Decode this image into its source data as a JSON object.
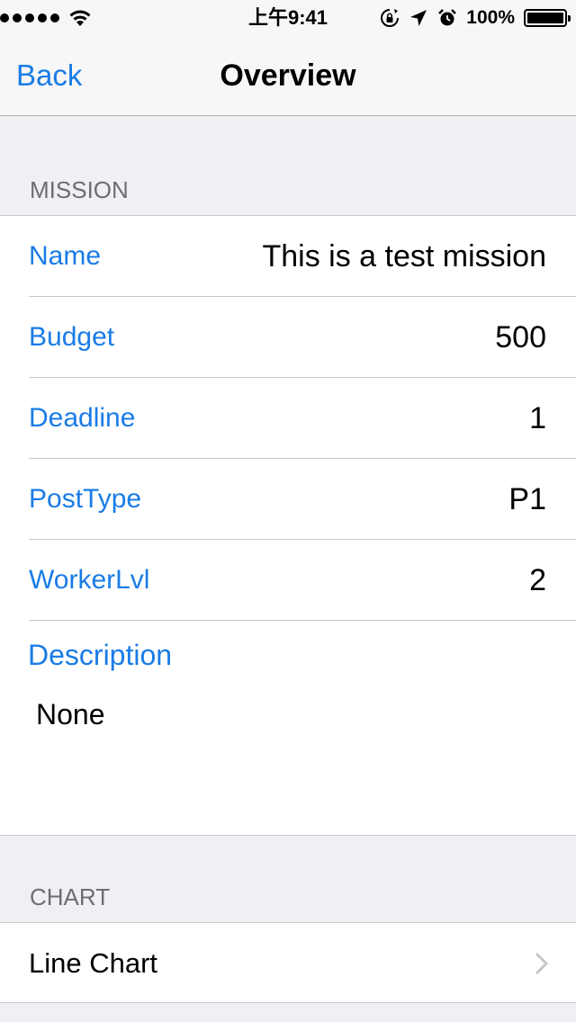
{
  "status_bar": {
    "time": "上午9:41",
    "battery_percent": "100%",
    "signal_dots": 5,
    "icons": [
      "signal-dots-icon",
      "wifi-icon",
      "rotation-lock-icon",
      "location-arrow-icon",
      "alarm-icon",
      "battery-icon"
    ]
  },
  "nav": {
    "back_label": "Back",
    "title": "Overview"
  },
  "mission": {
    "header": "MISSION",
    "rows": [
      {
        "label": "Name",
        "value": "This is a test mission"
      },
      {
        "label": "Budget",
        "value": "500"
      },
      {
        "label": "Deadline",
        "value": "1"
      },
      {
        "label": "PostType",
        "value": "P1"
      },
      {
        "label": "WorkerLvl",
        "value": "2"
      }
    ],
    "description_label": "Description",
    "description_value": "None"
  },
  "chart": {
    "header": "CHART",
    "row_label": "Line Chart"
  },
  "colors": {
    "accent": "#1a7ce6",
    "background": "#efeff4",
    "separator": "#c8c7cc",
    "section_header": "#6d6d72",
    "chevron": "#c7c7cc"
  }
}
